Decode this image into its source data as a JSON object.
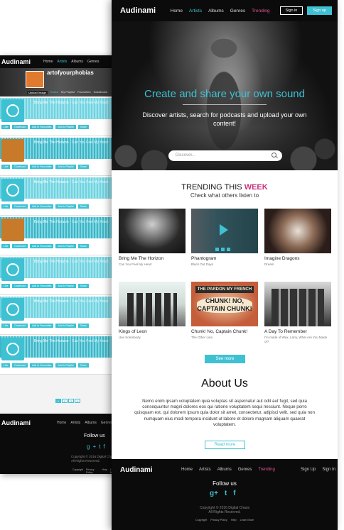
{
  "brand": "Audinami",
  "nav": {
    "links": [
      "Home",
      "Artists",
      "Albums",
      "Genres",
      "Trending"
    ],
    "signin": "Sign in",
    "signup": "Sign up"
  },
  "hero": {
    "title": "Create and share your own sound",
    "subtitle": "Discover artists, search for podcasts and upload your own content!",
    "search_placeholder": "Discover..."
  },
  "trending": {
    "heading_prefix": "TRENDING THIS",
    "heading_highlight": "WEEK",
    "subheading": "Check what others listen to",
    "cards": [
      {
        "name": "Bring Me The Horizon",
        "sub": "Can You Feel My Heart"
      },
      {
        "name": "Phantogram",
        "sub": "Black Out Days"
      },
      {
        "name": "Imagine Dragons",
        "sub": "Dream"
      },
      {
        "name": "Kings of Leon",
        "sub": "Use Somebody"
      },
      {
        "name": "Chunk! No, Captain Chunk!",
        "sub": "The Other Line"
      },
      {
        "name": "A Day To Remember",
        "sub": "I'm made of Wax, Larry, What Are You Made of?"
      }
    ],
    "art_text_1": "THE PARDON MY FRENCH",
    "art_text_2": "CHUNK! NO, CAPTAIN CHUNK!",
    "see_more": "See more"
  },
  "about": {
    "heading": "About Us",
    "body": "Nemo enim ipsam voluptatem quia voluptas sit aspernatur aut odit aut fugit, sed quia consequuntur magni dolores eos qui ratione voluptatem sequi nesciunt. Neque porro quisquam est, qui dolorem ipsum quia dolor sit amet, consectetur, adipisci velit, sed quia non numquam eius modi tempora incidunt ut labore et dolore magnam aliquam quaerat voluptatem.",
    "read_more": "Read more"
  },
  "footer": {
    "links": [
      "Home",
      "Artists",
      "Albums",
      "Genres",
      "Trending"
    ],
    "signup": "Sign Up",
    "signin": "Sign In",
    "follow": "Follow us",
    "social": [
      "g+",
      "t",
      "f"
    ],
    "copyright_1": "Copyright © 2016 Digital Chaos",
    "copyright_2": "All Rights Reserved.",
    "legal": [
      "Copyright",
      "Privacy Policy",
      "Help",
      "Learn More"
    ]
  },
  "back_page": {
    "brand": "Audinami",
    "nav": [
      "Home",
      "Artists",
      "Albums",
      "Genres"
    ],
    "profile_name": "artofyourphobias",
    "upload_badge": "Upload Image",
    "profile_tabs": [
      "Tracks",
      "My Playlist",
      "Favourites",
      "Dashboard"
    ],
    "track_title": "Bring Me The Horizon",
    "track_subtitle": "Can You Feel My Heart",
    "track_buttons": [
      "Like",
      "Download",
      "Add to Favourites",
      "Add to Playlist",
      "Share"
    ],
    "pages": [
      "1",
      "2",
      "3",
      "4"
    ],
    "footer_brand": "Audinami",
    "footer_links": [
      "Home",
      "Artists",
      "Albums",
      "Genres"
    ],
    "follow": "Follow us",
    "copyright_1": "Copyright © 2016 Digital Chaos",
    "copyright_2": "All Rights Reserved.",
    "legal": [
      "Copyright",
      "Privacy Policy",
      "Help",
      "Learn More"
    ]
  },
  "colors": {
    "accent": "#3ec1d3",
    "highlight": "#c8347d",
    "trending": "#e0589a",
    "dark": "#0b0b0b"
  }
}
